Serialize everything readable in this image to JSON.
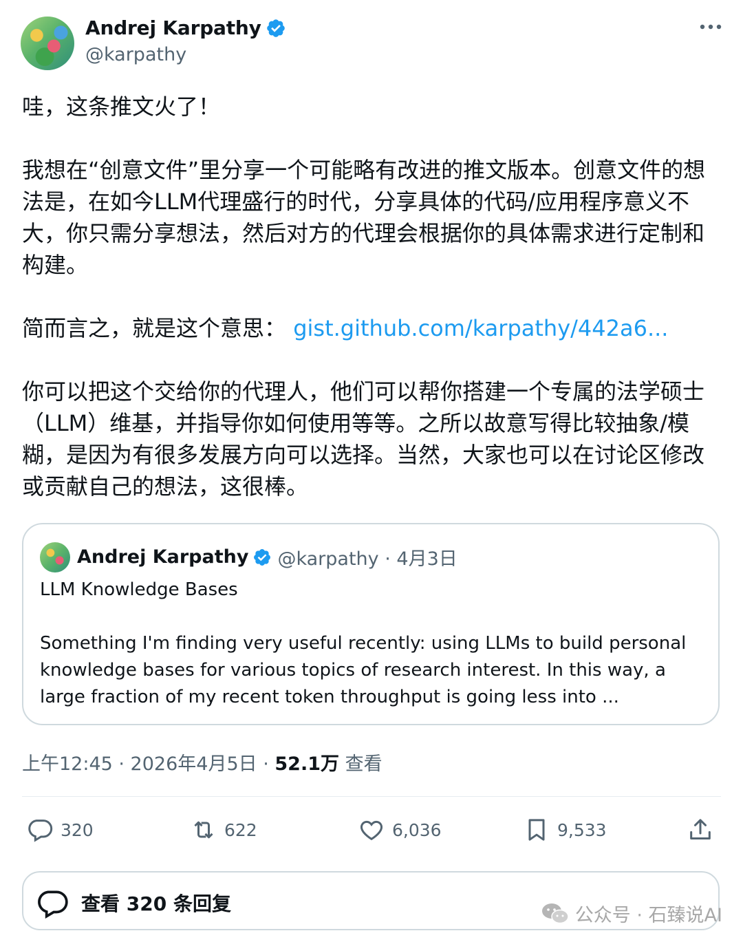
{
  "author": {
    "name": "Andrej Karpathy",
    "handle": "@karpathy"
  },
  "tweet": {
    "p1": "哇，这条推文火了！",
    "p2": "我想在“创意文件”里分享一个可能略有改进的推文版本。创意文件的想法是，在如今LLM代理盛行的时代，分享具体的代码/应用程序意义不大，你只需分享想法，然后对方的代理会根据你的具体需求进行定制和构建。",
    "p3_prefix": "简而言之，就是这个意思：",
    "p3_link": "gist.github.com/karpathy/442a6...",
    "p4": "你可以把这个交给你的代理人，他们可以帮你搭建一个专属的法学硕士（LLM）维基，并指导你如何使用等等。之所以故意写得比较抽象/模糊，是因为有很多发展方向可以选择。当然，大家也可以在讨论区修改或贡献自己的想法，这很棒。"
  },
  "quote": {
    "name": "Andrej Karpathy",
    "meta": "@karpathy · 4月3日",
    "title": "LLM Knowledge Bases",
    "body": "Something I'm finding very useful recently: using LLMs to build personal knowledge bases for various topics of research interest. In this way, a large fraction of my recent token throughput is going less into ..."
  },
  "timestamp": {
    "time": "上午12:45 · 2026年4月5日 · ",
    "views": "52.1万",
    "views_label": " 查看"
  },
  "actions": {
    "reply": "320",
    "retweet": "622",
    "like": "6,036",
    "bookmark": "9,533"
  },
  "replies_button": "查看 320 条回复",
  "watermark": "公众号 · 石臻说AI",
  "colors": {
    "link": "#1d9bf0",
    "verified": "#1d9bf0",
    "muted": "#536471",
    "border": "#cfd9de"
  },
  "icons": [
    "verified-badge-icon",
    "more-icon",
    "reply-icon",
    "retweet-icon",
    "like-icon",
    "bookmark-icon",
    "share-icon",
    "comment-bubble-icon",
    "wechat-icon"
  ]
}
